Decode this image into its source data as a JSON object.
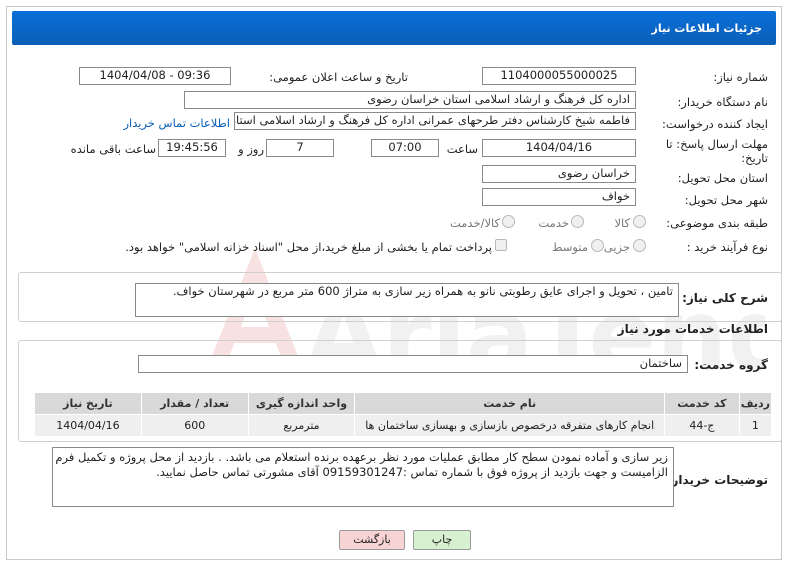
{
  "header": {
    "title": "جزئیات اطلاعات نیاز"
  },
  "form": {
    "need_number_label": "شماره نیاز:",
    "need_number": "1104000055000025",
    "announce_label": "تاریخ و ساعت اعلان عمومی:",
    "announce_value": "1404/04/08 - 09:36",
    "buyer_org_label": "نام دستگاه خریدار:",
    "buyer_org": "اداره کل فرهنگ و ارشاد اسلامی استان خراسان رضوی",
    "requester_label": "ایجاد کننده درخواست:",
    "requester": "فاطمه شیخ کارشناس دفتر طرحهای عمرانی اداره کل فرهنگ و ارشاد اسلامی استان خراسان رضوی",
    "contact_link": "اطلاعات تماس خریدار",
    "deadline_label_1": "مهلت ارسال پاسخ: تا",
    "deadline_label_2": "تاریخ:",
    "deadline_date": "1404/04/16",
    "hour_label": "ساعت",
    "deadline_time": "07:00",
    "days_value": "7",
    "days_label": "روز و",
    "remaining_time": "19:45:56",
    "remaining_label": "ساعت باقی مانده",
    "province_label": "استان محل تحویل:",
    "province": "خراسان رضوی",
    "city_label": "شهر محل تحویل:",
    "city": "خواف",
    "category_label": "طبقه بندی موضوعی:",
    "category_options": [
      "کالا",
      "خدمت",
      "کالا/خدمت"
    ],
    "process_label": "نوع فرآیند خرید :",
    "process_options": [
      "جزیی",
      "متوسط"
    ],
    "payment_note": "پرداخت تمام یا بخشی از مبلغ خرید،از محل \"اسناد خزانه اسلامی\" خواهد بود."
  },
  "summary": {
    "label": "شرح کلی نیاز:",
    "text": "تامین ، تحویل و اجرای عایق رطوبتی نانو به همراه زیر سازی به متراژ 600 متر مربع در شهرستان خواف."
  },
  "services": {
    "section_title": "اطلاعات خدمات مورد نیاز",
    "group_label": "گروه خدمت:",
    "group_value": "ساختمان",
    "columns": [
      "ردیف",
      "کد خدمت",
      "نام خدمت",
      "واحد اندازه گیری",
      "تعداد / مقدار",
      "تاریخ نیاز"
    ],
    "rows": [
      [
        "1",
        "ج-44",
        "انجام کارهای متفرقه درخصوص بازسازی و بهسازی ساختمان ها",
        "مترمربع",
        "600",
        "1404/04/16"
      ]
    ]
  },
  "buyer_notes": {
    "label": "توضیحات خریدار:",
    "text": "زیر سازی و آماده نمودن سطح کار مطابق عملیات مورد نظر برعهده برنده استعلام می باشد. . بازدید از محل پروژه و تکمیل فرم الزامیست و جهت بازدید از پروژه فوق با شماره تماس :09159301247 آقای مشورتی تماس حاصل نمایید."
  },
  "buttons": {
    "print": "چاپ",
    "back": "بازگشت"
  },
  "watermark": {
    "text": "AriaTender.neT"
  },
  "colors": {
    "title_bar": "#0a5fb8",
    "print_btn": "#d7f0cf",
    "back_btn": "#f7d3d3",
    "link": "#0a5fb8"
  }
}
